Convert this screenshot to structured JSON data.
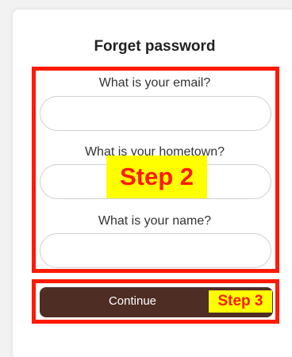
{
  "form": {
    "title": "Forget password",
    "fields": [
      {
        "label": "What is your email?",
        "value": ""
      },
      {
        "label": "What is your hometown?",
        "value": ""
      },
      {
        "label": "What is your name?",
        "value": ""
      }
    ],
    "continue_label": "Continue"
  },
  "annotations": {
    "step2": "Step 2",
    "step3": "Step 3",
    "highlight_color": "#ff1a00",
    "badge_color": "#ffff00"
  }
}
